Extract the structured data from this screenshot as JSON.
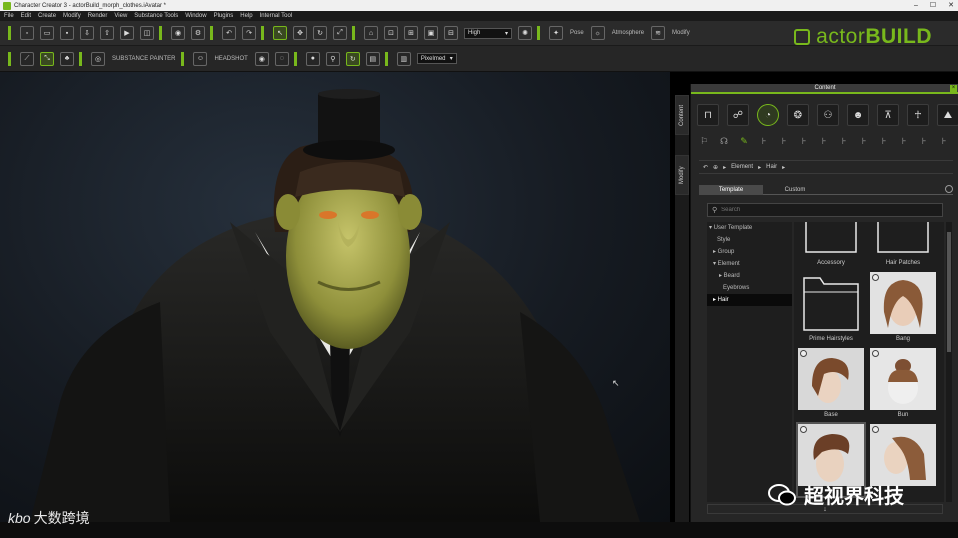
{
  "window": {
    "title": "Character Creator 3 - actorBuild_morph_clothes.iAvatar *",
    "controls": [
      "–",
      "☐",
      "✕"
    ]
  },
  "menu": [
    "File",
    "Edit",
    "Create",
    "Modify",
    "Render",
    "View",
    "Substance Tools",
    "Window",
    "Plugins",
    "Help",
    "Internal Tool"
  ],
  "toolbar": {
    "quality_select": "High",
    "label_pose": "Pose",
    "label_atmosphere": "Atmosphere",
    "label_modify": "Modify",
    "label_substance_painter": "SUBSTANCE PAINTER",
    "label_headshot": "HEADSHOT",
    "shading_select": "Pixelmed"
  },
  "brand": {
    "prefix": "actor",
    "suffix": "BUILD"
  },
  "side_tabs": {
    "content": "Content",
    "modify": "Modify"
  },
  "panel": {
    "title": "Content",
    "breadcrumb": [
      "Element",
      "Hair"
    ],
    "tabs": [
      "Template",
      "Custom"
    ],
    "search_placeholder": "Search",
    "tree": [
      {
        "label": "▾ User Template",
        "indent": 0
      },
      {
        "label": "Style",
        "indent": 1
      },
      {
        "label": "▸ Group",
        "indent": 1
      },
      {
        "label": "▾ Element",
        "indent": 1
      },
      {
        "label": "▸ Beard",
        "indent": 2
      },
      {
        "label": "Eyebrows",
        "indent": 2
      },
      {
        "label": "▸ Hair",
        "indent": 2,
        "selected": true
      }
    ],
    "tiles": [
      {
        "caption": "Accessory",
        "kind": "folder"
      },
      {
        "caption": "Hair Patches",
        "kind": "folder"
      },
      {
        "caption": "Prime Hairstyles",
        "kind": "folder"
      },
      {
        "caption": "Bang",
        "kind": "hair-long"
      },
      {
        "caption": "Base",
        "kind": "hair-short"
      },
      {
        "caption": "Bun",
        "kind": "hair-bun"
      },
      {
        "caption": "",
        "kind": "hair-quiff"
      },
      {
        "caption": "",
        "kind": "hair-bob"
      }
    ],
    "scroll_arrow": "↓"
  },
  "watermarks": {
    "left_logo": "kbo",
    "left_text": "大数跨境",
    "right_text": "超视界科技"
  },
  "colors": {
    "accent": "#78b81c"
  }
}
